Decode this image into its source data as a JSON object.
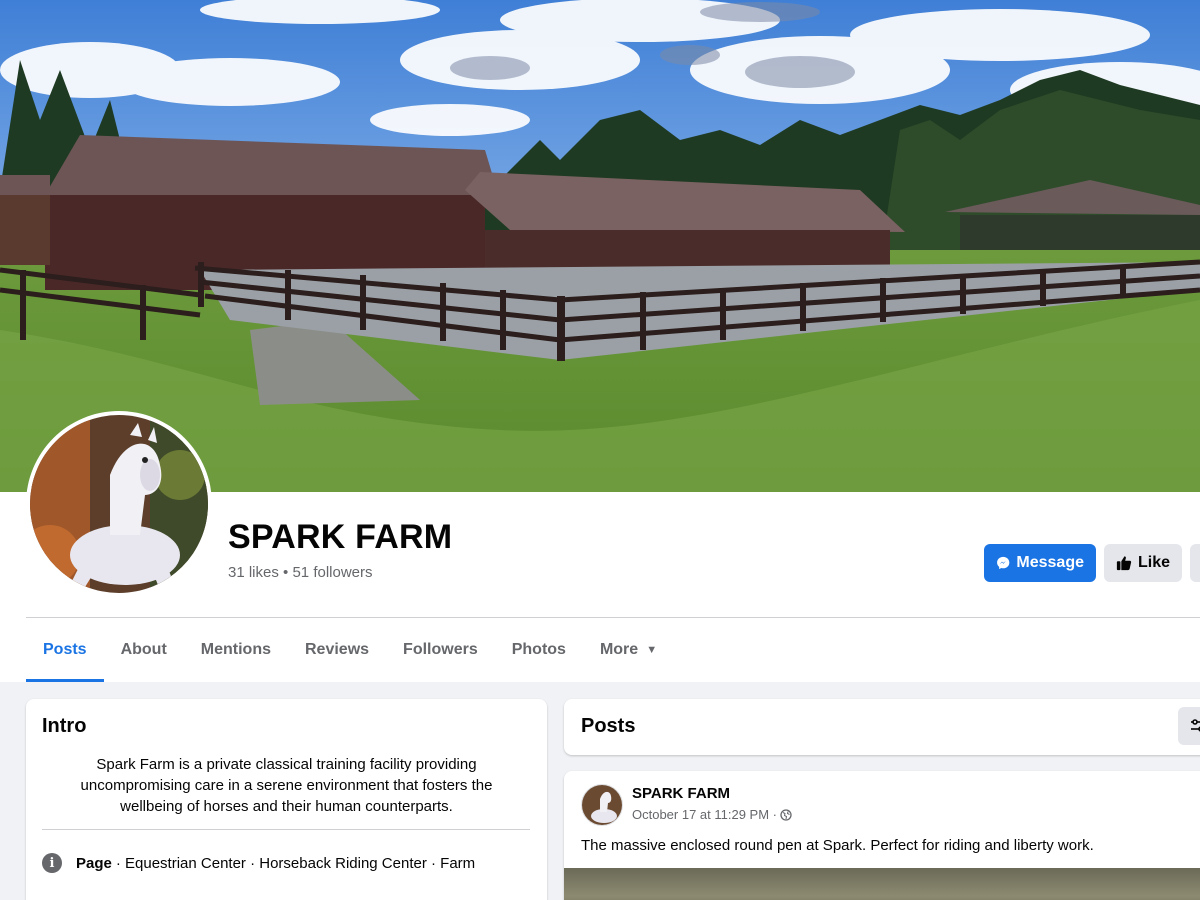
{
  "page": {
    "name": "SPARK FARM",
    "likes": "31 likes",
    "separator": "•",
    "followers": "51 followers"
  },
  "actions": {
    "message_label": "Message",
    "like_label": "Like"
  },
  "tabs": [
    {
      "label": "Posts",
      "active": true
    },
    {
      "label": "About"
    },
    {
      "label": "Mentions"
    },
    {
      "label": "Reviews"
    },
    {
      "label": "Followers"
    },
    {
      "label": "Photos"
    },
    {
      "label": "More"
    }
  ],
  "intro": {
    "heading": "Intro",
    "description": "Spark Farm is a private classical training facility providing uncompromising care in a serene environment that fosters the wellbeing of horses and their human counterparts.",
    "category_label": "Page",
    "categories": "· Equestrian Center · Horseback Riding Center · Farm"
  },
  "posts_section": {
    "heading": "Posts"
  },
  "post": {
    "author": "SPARK FARM",
    "timestamp": "October 17 at 11:29 PM ·",
    "text": "The massive enclosed round pen at Spark. Perfect for riding and liberty work."
  },
  "colors": {
    "accent": "#1b74e4",
    "background": "#f0f2f5",
    "secondary_text": "#65676b",
    "button_gray": "#e4e6eb"
  },
  "icons": {
    "message": "messenger-icon",
    "like": "thumbs-up-icon",
    "more_caret": "caret-down-icon",
    "info": "info-icon",
    "privacy": "globe-icon",
    "filter": "filter-icon"
  }
}
